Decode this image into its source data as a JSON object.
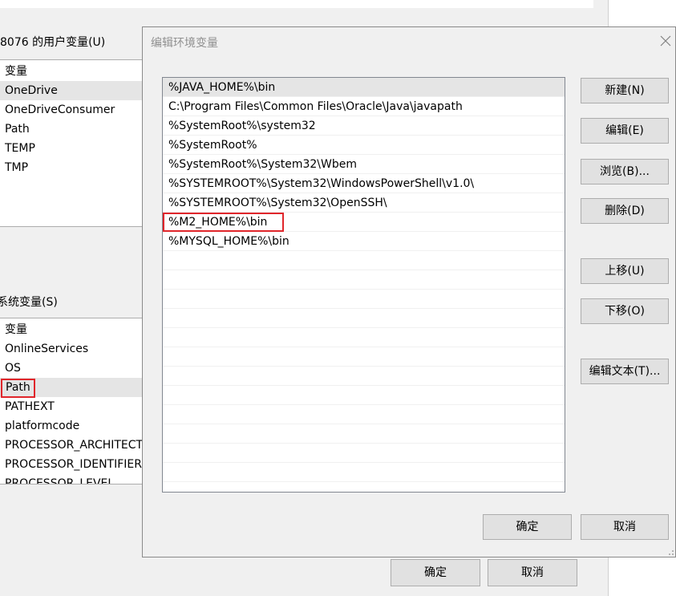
{
  "background_window": {
    "user_vars_label": "8076 的用户变量(U)",
    "user_vars": {
      "header": "变量",
      "rows": [
        "OneDrive",
        "OneDriveConsumer",
        "Path",
        "TEMP",
        "TMP"
      ]
    },
    "system_vars_label": "系统变量(S)",
    "system_vars": {
      "header": "变量",
      "rows": [
        "OnlineServices",
        "OS",
        "Path",
        "PATHEXT",
        "platformcode",
        "PROCESSOR_ARCHITECT",
        "PROCESSOR_IDENTIFIER",
        "PROCESSOR_LEVEL"
      ]
    },
    "ok_label": "确定",
    "cancel_label": "取消"
  },
  "dialog": {
    "title": "编辑环境变量",
    "paths": [
      "%JAVA_HOME%\\bin",
      "C:\\Program Files\\Common Files\\Oracle\\Java\\javapath",
      "%SystemRoot%\\system32",
      "%SystemRoot%",
      "%SystemRoot%\\System32\\Wbem",
      "%SYSTEMROOT%\\System32\\WindowsPowerShell\\v1.0\\",
      "%SYSTEMROOT%\\System32\\OpenSSH\\",
      "%M2_HOME%\\bin",
      "%MYSQL_HOME%\\bin"
    ],
    "buttons": {
      "new": "新建(N)",
      "edit": "编辑(E)",
      "browse": "浏览(B)...",
      "delete": "删除(D)",
      "move_up": "上移(U)",
      "move_down": "下移(O)",
      "edit_text": "编辑文本(T)...",
      "ok": "确定",
      "cancel": "取消"
    }
  }
}
